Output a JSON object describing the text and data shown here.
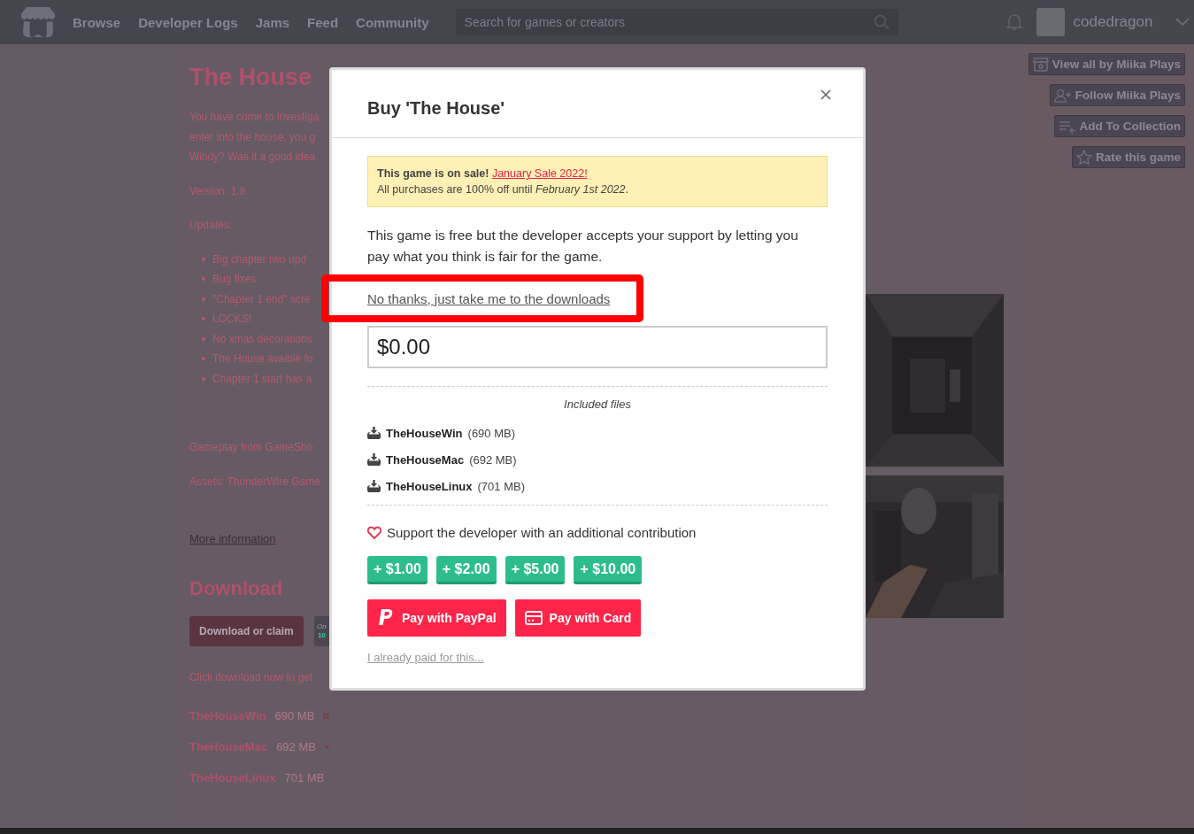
{
  "topbar": {
    "nav": [
      "Browse",
      "Developer Logs",
      "Jams",
      "Feed",
      "Community"
    ],
    "search": {
      "placeholder": "Search for games or creators"
    },
    "username": "codedragon"
  },
  "sidebar_buttons": [
    {
      "label": "View all by Miika Plays",
      "kind": "store"
    },
    {
      "label": "Follow Miika Plays",
      "kind": "follow"
    },
    {
      "label": "Add To Collection",
      "kind": "collection"
    },
    {
      "label": "Rate this game",
      "kind": "rate"
    }
  ],
  "page": {
    "title": "The House",
    "intro": [
      "You have come to investiga",
      "enter into the house, you g",
      "Windy? Was it a good idea"
    ],
    "version": "Version: 1.8",
    "updates_heading": "Updates:",
    "updates": [
      "Big chapter two upd",
      "Bug fixes",
      "\"Chapter 1 end\" scre",
      "LOCKS!",
      "No xmas decorations",
      "The House avaible fo",
      "Chapter 1 start has a"
    ],
    "gameplay": "Gameplay from GameSho",
    "assets": "Assets: ThunderWire Game",
    "more_information": "More information",
    "download_heading": "Download",
    "download_button": "Download or claim",
    "partial_box": [
      "On",
      "10"
    ],
    "download_note": "Click download now to get",
    "files": [
      {
        "name": "TheHouseWin",
        "size": "690 MB",
        "kind": "windows"
      },
      {
        "name": "TheHouseMac",
        "size": "692 MB",
        "kind": "mac"
      },
      {
        "name": "TheHouseLinux",
        "size": "701 MB",
        "kind": "linux"
      }
    ]
  },
  "modal": {
    "title": "Buy 'The House'",
    "sale": {
      "text": "This game is on sale!",
      "link": "January Sale 2022!",
      "detail": "All purchases are 100% off until *February 1st 2022*."
    },
    "description": "This game is free but the developer accepts your support by letting you pay what you think is fair for the game.",
    "skip_link": "No thanks, just take me to the downloads",
    "price": "$0.00",
    "included_heading": "Included files",
    "files": [
      {
        "name": "TheHouseWin",
        "size": "(690 MB)"
      },
      {
        "name": "TheHouseMac",
        "size": "(692 MB)"
      },
      {
        "name": "TheHouseLinux",
        "size": "(701 MB)"
      }
    ],
    "support": "Support the developer with an additional contribution",
    "tips": [
      "+ $1.00",
      "+ $2.00",
      "+ $5.00",
      "+ $10.00"
    ],
    "pay_buttons": [
      {
        "label": "Pay with PayPal",
        "kind": "paypal"
      },
      {
        "label": "Pay with Card",
        "kind": "card"
      }
    ],
    "already_paid": "I already paid for this..."
  }
}
